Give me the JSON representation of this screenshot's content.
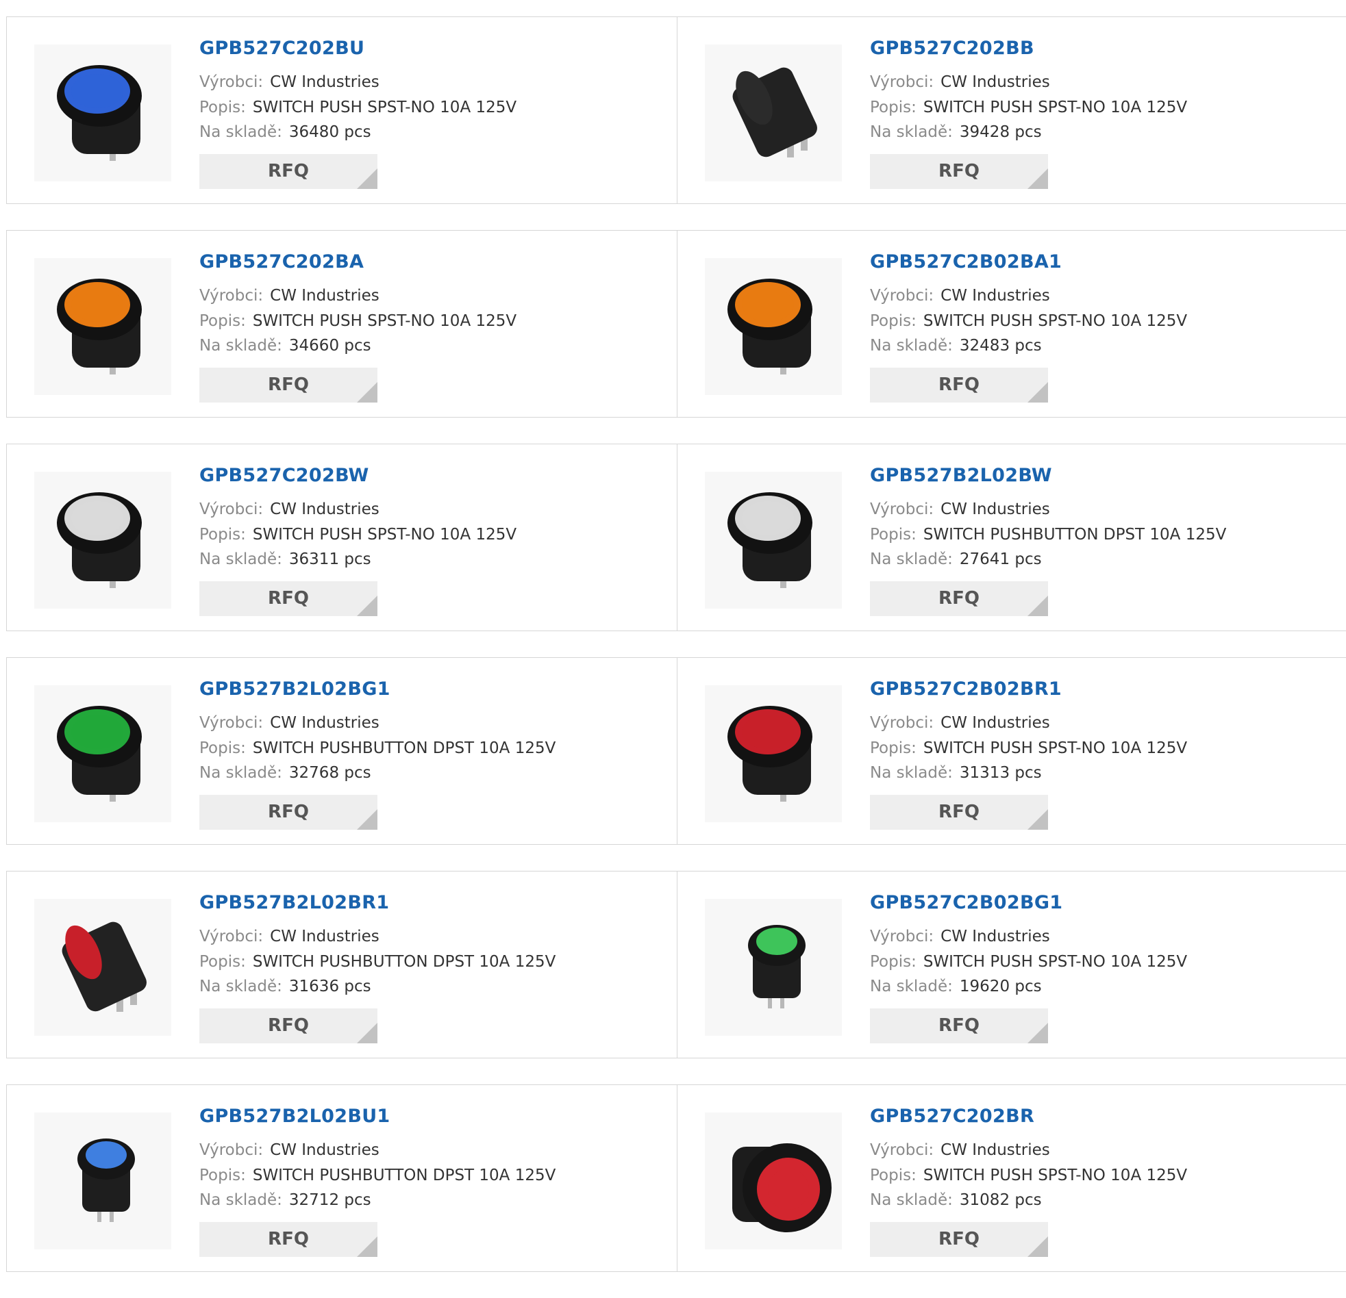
{
  "labels": {
    "manufacturer": "Výrobci:",
    "description": "Popis:",
    "stock": "Na skladě:",
    "rfq": "RFQ"
  },
  "products": [
    {
      "part": "GPB527C202BU",
      "manufacturer": "CW Industries",
      "description": "SWITCH PUSH SPST-NO 10A 125V",
      "stock": "36480 pcs",
      "lens_color": "#2f63d8",
      "shape": "round"
    },
    {
      "part": "GPB527C202BB",
      "manufacturer": "CW Industries",
      "description": "SWITCH PUSH SPST-NO 10A 125V",
      "stock": "39428 pcs",
      "lens_color": "#2b2b2b",
      "shape": "side"
    },
    {
      "part": "GPB527C202BA",
      "manufacturer": "CW Industries",
      "description": "SWITCH PUSH SPST-NO 10A 125V",
      "stock": "34660 pcs",
      "lens_color": "#e87b12",
      "shape": "round"
    },
    {
      "part": "GPB527C2B02BA1",
      "manufacturer": "CW Industries",
      "description": "SWITCH PUSH SPST-NO 10A 125V",
      "stock": "32483 pcs",
      "lens_color": "#e87b12",
      "shape": "round"
    },
    {
      "part": "GPB527C202BW",
      "manufacturer": "CW Industries",
      "description": "SWITCH PUSH SPST-NO 10A 125V",
      "stock": "36311 pcs",
      "lens_color": "#d9d9d9",
      "shape": "round"
    },
    {
      "part": "GPB527B2L02BW",
      "manufacturer": "CW Industries",
      "description": "SWITCH PUSHBUTTON DPST 10A 125V",
      "stock": "27641 pcs",
      "lens_color": "#d9d9d9",
      "shape": "round"
    },
    {
      "part": "GPB527B2L02BG1",
      "manufacturer": "CW Industries",
      "description": "SWITCH PUSHBUTTON DPST 10A 125V",
      "stock": "32768 pcs",
      "lens_color": "#22a83a",
      "shape": "round"
    },
    {
      "part": "GPB527C2B02BR1",
      "manufacturer": "CW Industries",
      "description": "SWITCH PUSH SPST-NO 10A 125V",
      "stock": "31313 pcs",
      "lens_color": "#c8202a",
      "shape": "round"
    },
    {
      "part": "GPB527B2L02BR1",
      "manufacturer": "CW Industries",
      "description": "SWITCH PUSHBUTTON DPST 10A 125V",
      "stock": "31636 pcs",
      "lens_color": "#c8202a",
      "shape": "side"
    },
    {
      "part": "GPB527C2B02BG1",
      "manufacturer": "CW Industries",
      "description": "SWITCH PUSH SPST-NO 10A 125V",
      "stock": "19620 pcs",
      "lens_color": "#3ec45a",
      "shape": "small"
    },
    {
      "part": "GPB527B2L02BU1",
      "manufacturer": "CW Industries",
      "description": "SWITCH PUSHBUTTON DPST 10A 125V",
      "stock": "32712 pcs",
      "lens_color": "#3f7fe0",
      "shape": "small"
    },
    {
      "part": "GPB527C202BR",
      "manufacturer": "CW Industries",
      "description": "SWITCH PUSH SPST-NO 10A 125V",
      "stock": "31082 pcs",
      "lens_color": "#d3262f",
      "shape": "front"
    }
  ]
}
